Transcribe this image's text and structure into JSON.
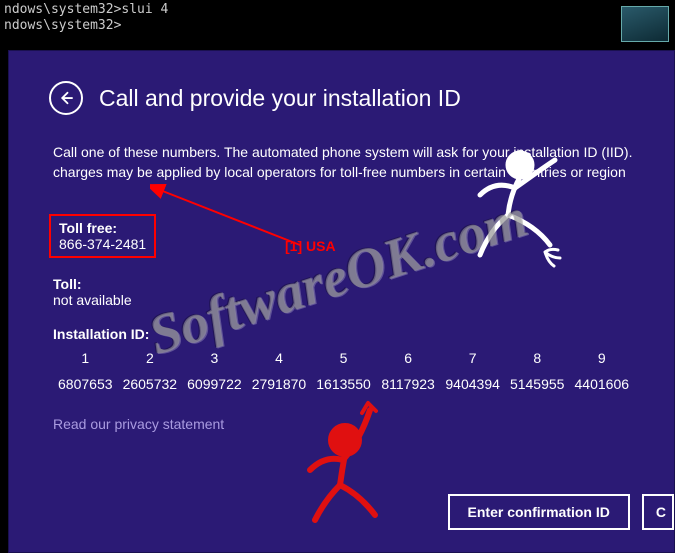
{
  "terminal": {
    "line1": "ndows\\system32>slui 4",
    "line2": "ndows\\system32>"
  },
  "dialog": {
    "title": "Call and provide your installation ID",
    "description": "Call one of these numbers. The automated phone system will ask for your installation ID (IID). charges may be applied by local operators for toll-free numbers in certain countries or region",
    "toll_free_label": "Toll free:",
    "toll_free_number": "866-374-2481",
    "toll_label": "Toll:",
    "toll_value": "not available",
    "installation_id_label": "Installation ID:",
    "installation_id_cols": [
      {
        "n": "1",
        "v": "6807653"
      },
      {
        "n": "2",
        "v": "2605732"
      },
      {
        "n": "3",
        "v": "6099722"
      },
      {
        "n": "4",
        "v": "2791870"
      },
      {
        "n": "5",
        "v": "1613550"
      },
      {
        "n": "6",
        "v": "8117923"
      },
      {
        "n": "7",
        "v": "9404394"
      },
      {
        "n": "8",
        "v": "5145955"
      },
      {
        "n": "9",
        "v": "4401606"
      }
    ],
    "privacy_link": "Read our privacy statement",
    "btn_confirm": "Enter confirmation ID",
    "btn_cut": "C"
  },
  "annotation": {
    "label": "[1] USA"
  },
  "watermark": "SoftwareOK.com"
}
